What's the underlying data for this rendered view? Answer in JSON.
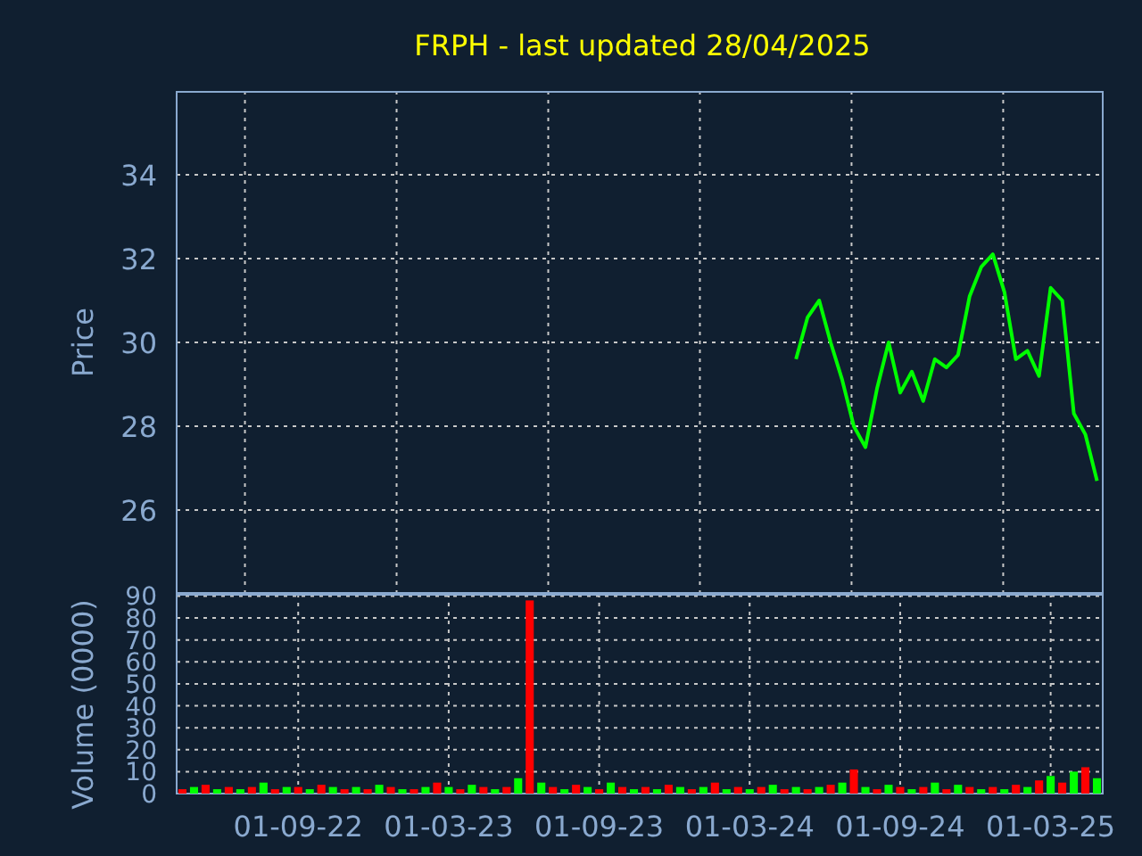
{
  "title": "FRPH - last updated 28/04/2025",
  "price_chart": {
    "chart_data": {
      "type": "line",
      "ylabel": "Price",
      "grid": true,
      "ylim": [
        24,
        36
      ],
      "yticks": [
        26,
        28,
        30,
        32,
        34
      ],
      "categories": [
        null,
        null,
        null,
        null,
        null,
        null,
        null,
        null,
        null,
        null,
        null,
        null,
        null,
        null,
        null,
        null,
        null,
        null,
        null,
        null,
        null,
        null,
        null,
        null,
        null,
        null,
        null,
        null,
        null,
        null,
        null,
        null,
        null,
        null,
        null,
        null,
        null,
        null,
        null,
        null,
        null,
        null,
        null,
        null,
        null,
        null,
        null,
        null,
        null,
        null,
        null,
        null,
        null,
        null,
        null,
        null,
        null,
        null,
        null,
        null,
        null,
        null,
        null,
        null,
        null,
        null,
        null,
        null,
        null,
        null,
        null,
        null,
        null,
        null,
        null,
        null,
        null,
        null,
        null,
        null
      ],
      "series": [
        {
          "color": "#00ff00",
          "values": [
            null,
            null,
            null,
            null,
            null,
            null,
            null,
            null,
            null,
            null,
            null,
            null,
            null,
            null,
            null,
            null,
            null,
            null,
            null,
            null,
            null,
            null,
            null,
            null,
            null,
            null,
            null,
            null,
            null,
            null,
            null,
            null,
            null,
            null,
            null,
            null,
            null,
            null,
            null,
            null,
            null,
            null,
            null,
            null,
            null,
            null,
            null,
            null,
            null,
            null,
            null,
            null,
            null,
            29.6,
            30.6,
            31.0,
            30.0,
            29.1,
            28.0,
            27.5,
            28.9,
            30.0,
            28.8,
            29.3,
            28.6,
            29.6,
            29.4,
            29.7,
            31.1,
            31.8,
            32.1,
            31.2,
            29.6,
            29.8,
            29.2,
            31.3,
            31.0,
            28.3,
            27.8,
            26.7
          ]
        }
      ]
    }
  },
  "volume_chart": {
    "chart_data": {
      "type": "bar",
      "ylabel": "Volume (0000)",
      "grid": true,
      "ylim": [
        0,
        91
      ],
      "yticks": [
        0,
        10,
        20,
        30,
        40,
        50,
        60,
        70,
        80,
        90
      ],
      "categories": [
        null,
        null,
        null,
        null,
        null,
        null,
        null,
        null,
        null,
        null,
        "01-09-22",
        null,
        null,
        null,
        null,
        null,
        null,
        null,
        null,
        null,
        null,
        null,
        null,
        "01-03-23",
        null,
        null,
        null,
        null,
        null,
        null,
        null,
        null,
        null,
        null,
        null,
        null,
        "01-09-23",
        null,
        null,
        null,
        null,
        null,
        null,
        null,
        null,
        null,
        null,
        null,
        null,
        "01-03-24",
        null,
        null,
        null,
        null,
        null,
        null,
        null,
        null,
        null,
        null,
        null,
        null,
        "01-09-24",
        null,
        null,
        null,
        null,
        null,
        null,
        null,
        null,
        null,
        null,
        null,
        null,
        "01-03-25",
        null,
        null,
        null,
        null
      ],
      "series": [
        {
          "color": "#ff0000",
          "values": [
            2,
            null,
            4,
            null,
            3,
            null,
            3,
            null,
            2,
            null,
            3,
            null,
            4,
            null,
            2,
            null,
            2,
            null,
            3,
            null,
            2,
            null,
            5,
            null,
            2,
            null,
            3,
            null,
            3,
            null,
            88,
            null,
            3,
            null,
            4,
            null,
            2,
            null,
            3,
            null,
            3,
            null,
            4,
            null,
            2,
            null,
            5,
            null,
            3,
            null,
            3,
            null,
            2,
            null,
            2,
            null,
            4,
            null,
            11,
            null,
            2,
            null,
            3,
            null,
            3,
            null,
            2,
            null,
            3,
            null,
            3,
            null,
            4,
            null,
            6,
            null,
            5,
            null,
            12,
            null
          ]
        },
        {
          "color": "#00ff00",
          "values": [
            null,
            3,
            null,
            2,
            null,
            2,
            null,
            5,
            null,
            3,
            null,
            2,
            null,
            3,
            null,
            3,
            null,
            4,
            null,
            2,
            null,
            3,
            null,
            3,
            null,
            4,
            null,
            2,
            null,
            7,
            null,
            5,
            null,
            2,
            null,
            3,
            null,
            5,
            null,
            2,
            null,
            2,
            null,
            3,
            null,
            3,
            null,
            2,
            null,
            2,
            null,
            4,
            null,
            3,
            null,
            3,
            null,
            5,
            null,
            3,
            null,
            4,
            null,
            2,
            null,
            5,
            null,
            4,
            null,
            2,
            null,
            2,
            null,
            3,
            null,
            8,
            null,
            10,
            null,
            7
          ]
        }
      ]
    }
  }
}
